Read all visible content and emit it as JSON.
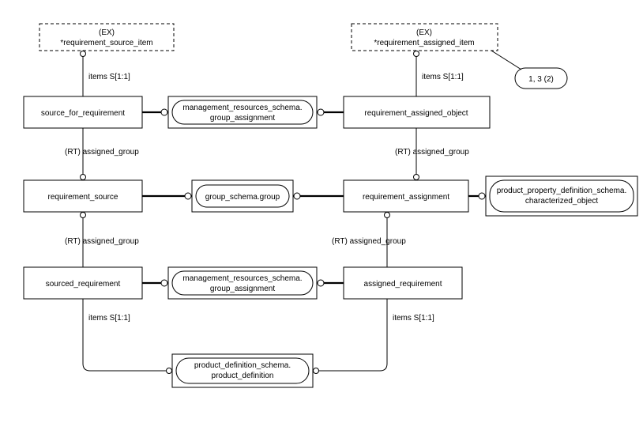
{
  "select_types": {
    "req_source_item": {
      "tag": "(EX)",
      "name": "*requirement_source_item"
    },
    "req_assigned_item": {
      "tag": "(EX)",
      "name": "*requirement_assigned_item"
    }
  },
  "entities": {
    "source_for_requirement": "source_for_requirement",
    "mgmt_group_assignment_1": {
      "line1": "management_resources_schema.",
      "line2": "group_assignment"
    },
    "requirement_assigned_object": "requirement_assigned_object",
    "requirement_source": "requirement_source",
    "group_schema_group": "group_schema.group",
    "requirement_assignment": "requirement_assignment",
    "ppds_characterized_object": {
      "line1": "product_property_definition_schema.",
      "line2": "characterized_object"
    },
    "sourced_requirement": "sourced_requirement",
    "mgmt_group_assignment_2": {
      "line1": "management_resources_schema.",
      "line2": "group_assignment"
    },
    "assigned_requirement": "assigned_requirement",
    "pds_product_definition": {
      "line1": "product_definition_schema.",
      "line2": "product_definition"
    }
  },
  "labels": {
    "items_s11_a": "items S[1:1]",
    "items_s11_b": "items S[1:1]",
    "items_s11_c": "items S[1:1]",
    "items_s11_d": "items S[1:1]",
    "rt_assigned_group_a": "(RT) assigned_group",
    "rt_assigned_group_b": "(RT) assigned_group",
    "rt_assigned_group_c": "(RT) assigned_group",
    "rt_assigned_group_d": "(RT) assigned_group"
  },
  "annotation": "1, 3 (2)"
}
